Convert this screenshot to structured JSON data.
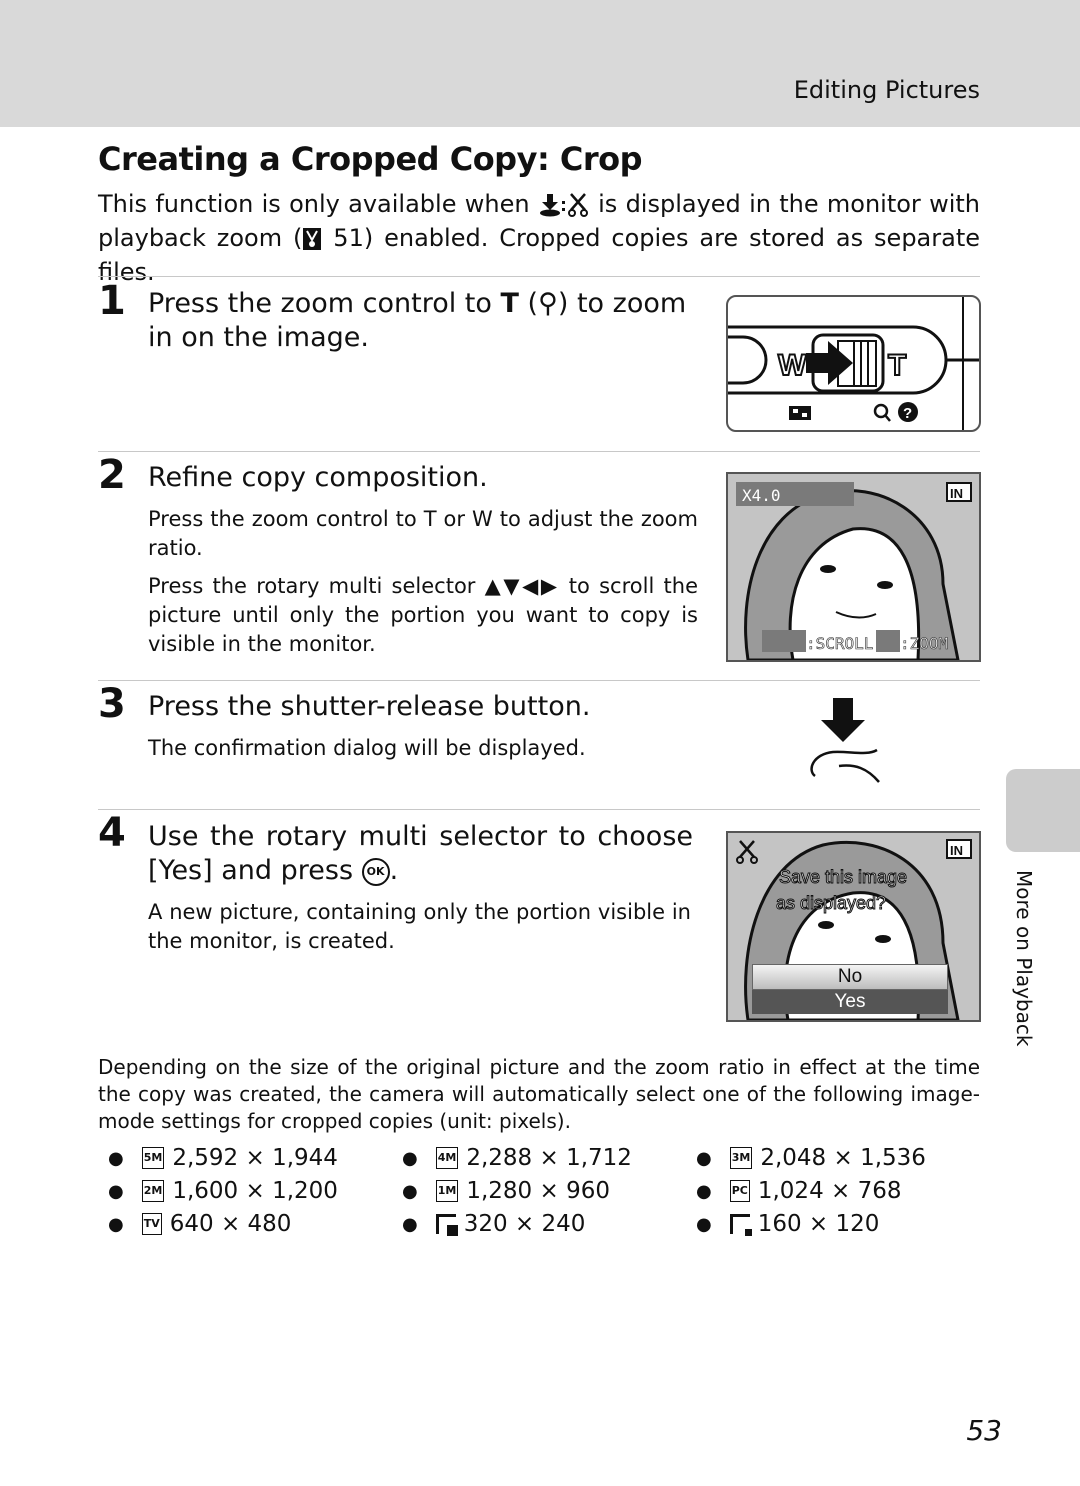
{
  "header": {
    "section": "Editing Pictures"
  },
  "title": "Creating a Cropped Copy: Crop",
  "intro": {
    "part1": "This function is only available when",
    "part2": "is displayed in the monitor with playback zoom (",
    "page_ref": "51",
    "part3": ") enabled. Cropped copies are stored as separate files."
  },
  "steps": [
    {
      "number": "1",
      "title_a": "Press the zoom control to",
      "title_b": "(",
      "title_c": ") to zoom in on the image.",
      "body": []
    },
    {
      "number": "2",
      "title": "Refine copy composition.",
      "body": [
        "Press the zoom control to T or W to adjust the zoom ratio.",
        "Press the rotary multi selector ▲▼◀▶ to scroll the picture until only the portion you want to copy is visible in the monitor."
      ]
    },
    {
      "number": "3",
      "title": "Press the shutter-release button.",
      "body": [
        "The confirmation dialog will be displayed."
      ]
    },
    {
      "number": "4",
      "title_a": "Use the rotary multi selector to choose [Yes] and press",
      "title_b": ".",
      "body": [
        "A new picture, containing only the portion visible in the monitor, is created."
      ]
    }
  ],
  "figures": {
    "zoom_control": {
      "w_label": "W",
      "t_label": "T"
    },
    "monitor1": {
      "zoom_text": "X4.0",
      "memory": "IN",
      "scroll_hint": ":SCROLL",
      "zoom_hint": ":ZOOM"
    },
    "monitor2": {
      "memory": "IN",
      "question": "Save this image as displayed?",
      "options": [
        "No",
        "Yes"
      ],
      "selected": "Yes"
    }
  },
  "footer_note": "Depending on the size of the original picture and the zoom ratio in effect at the time the copy was created, the camera will automatically select one of the following image-mode settings for cropped copies (unit: pixels).",
  "image_modes": [
    {
      "icon": "5M",
      "size": "2,592 × 1,944"
    },
    {
      "icon": "4M",
      "size": "2,288 × 1,712"
    },
    {
      "icon": "3M",
      "size": "2,048 × 1,536"
    },
    {
      "icon": "2M",
      "size": "1,600 × 1,200"
    },
    {
      "icon": "1M",
      "size": "1,280 × 960"
    },
    {
      "icon": "PC",
      "size": "1,024 × 768"
    },
    {
      "icon": "TV",
      "size": "640 × 480"
    },
    {
      "icon": "",
      "size": "320 × 240"
    },
    {
      "icon": "",
      "size": "160 × 120"
    }
  ],
  "side_tab": "More on Playback",
  "page_number": "53"
}
